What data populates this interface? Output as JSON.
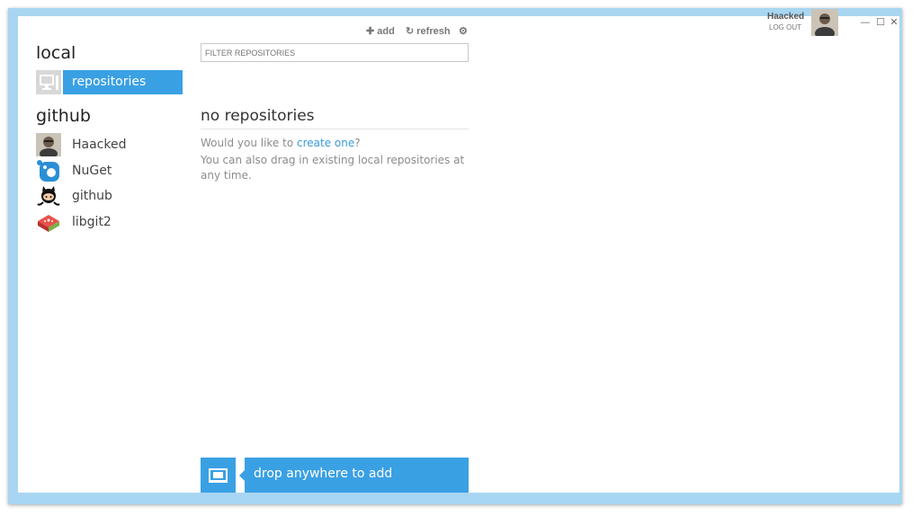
{
  "sidebar": {
    "local_heading": "local",
    "local_items": [
      {
        "label": "repositories"
      }
    ],
    "github_heading": "github",
    "orgs": [
      {
        "label": "Haacked"
      },
      {
        "label": "NuGet"
      },
      {
        "label": "github"
      },
      {
        "label": "libgit2"
      }
    ]
  },
  "toolbar": {
    "add_label": "add",
    "refresh_label": "refresh"
  },
  "filter": {
    "placeholder": "FILTER REPOSITORIES"
  },
  "empty_state": {
    "title": "no repositories",
    "line1_prefix": "Would you like to ",
    "line1_link": "create one",
    "line1_suffix": "?",
    "line2": "You can also drag in existing local repositories at any time."
  },
  "drop": {
    "label": "drop anywhere to add"
  },
  "user": {
    "name": "Haacked",
    "logout": "LOG OUT"
  },
  "window_controls": {
    "minimize": "—",
    "maximize": "☐",
    "close": "✕"
  },
  "colors": {
    "accent": "#3aa0e4",
    "frame": "#a8d6f2"
  }
}
